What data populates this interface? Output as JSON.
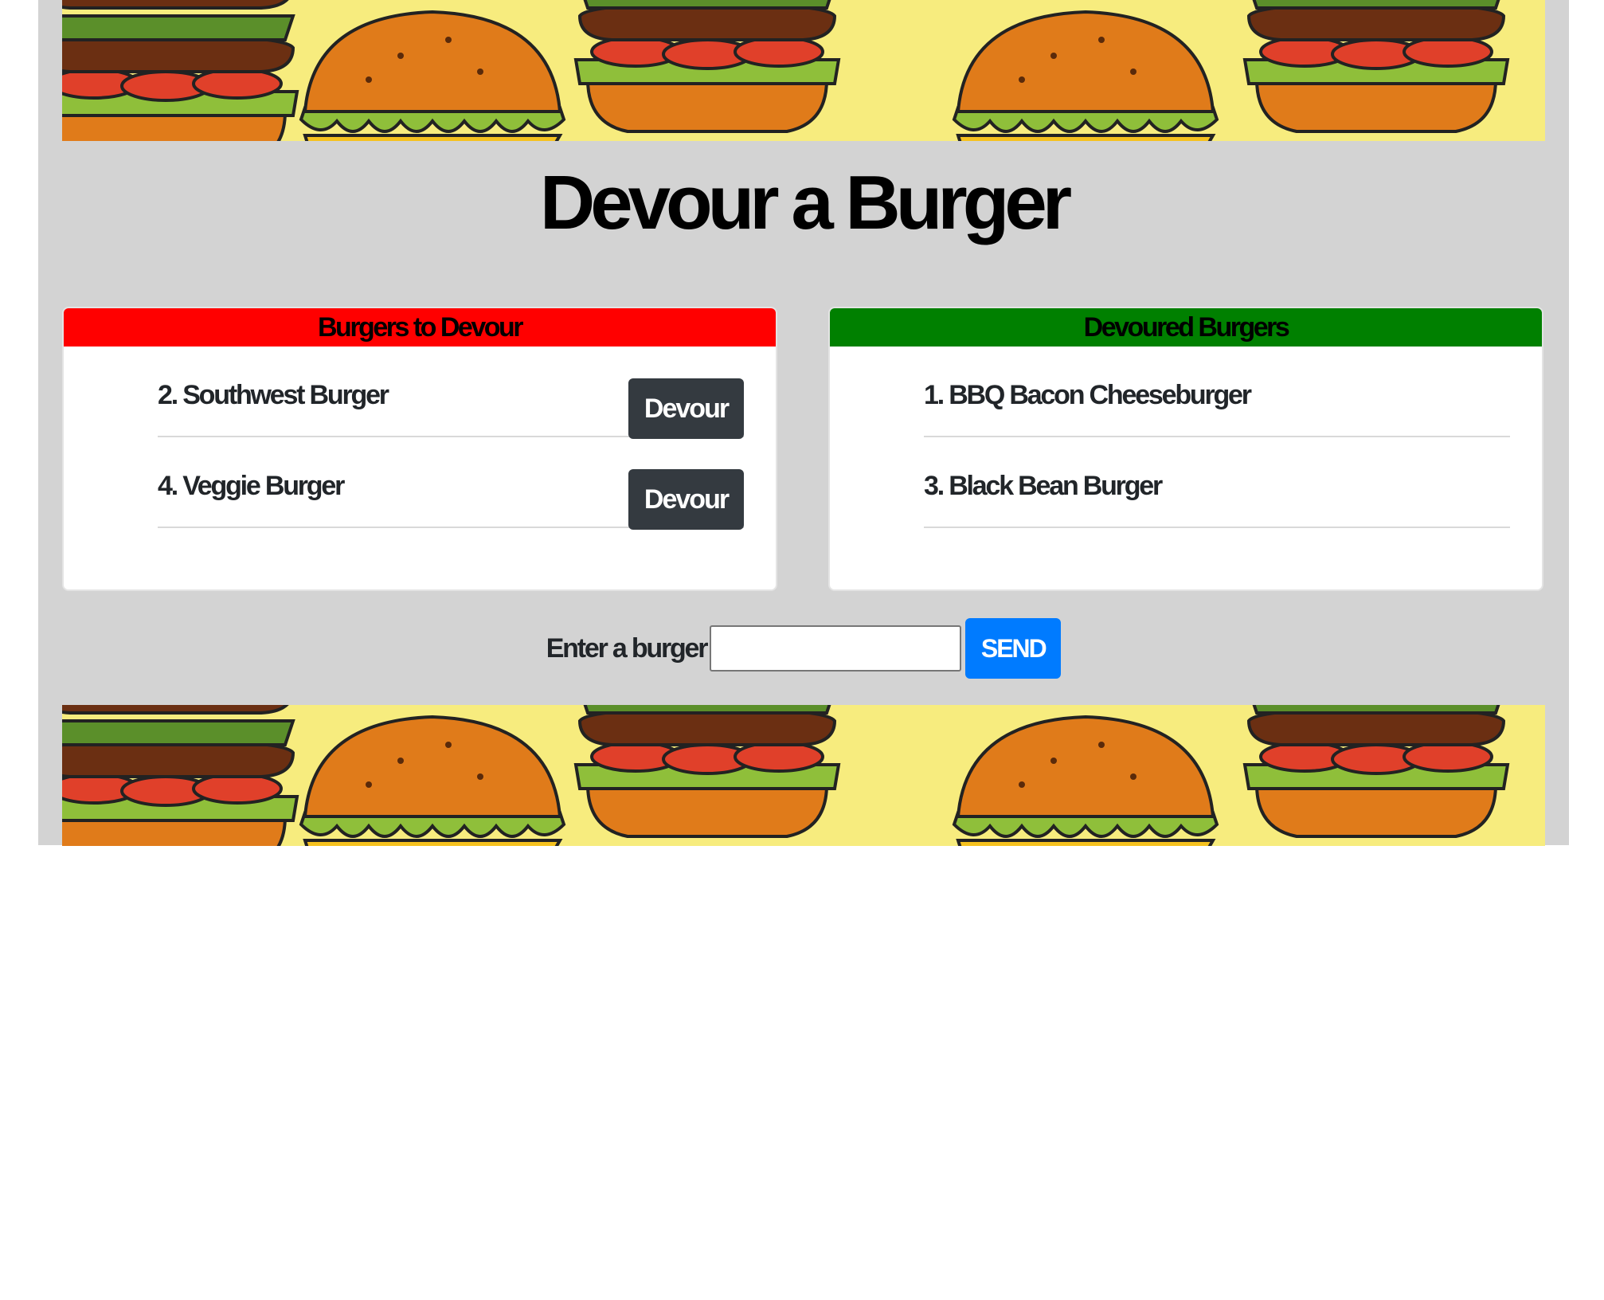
{
  "page": {
    "title": "Devour a Burger"
  },
  "to_devour": {
    "header": "Burgers to Devour",
    "items": [
      {
        "label": "2. Southwest Burger",
        "button": "Devour"
      },
      {
        "label": "4. Veggie Burger",
        "button": "Devour"
      }
    ]
  },
  "devoured": {
    "header": "Devoured Burgers",
    "items": [
      {
        "label": "1. BBQ Bacon Cheeseburger"
      },
      {
        "label": "3. Black Bean Burger"
      }
    ]
  },
  "form": {
    "label": "Enter a burger",
    "input_value": "",
    "submit_label": "SEND"
  },
  "colors": {
    "page_background": "#d3d3d3",
    "to_devour_header": "#ff0000",
    "devoured_header": "#008000",
    "devour_button": "#343a40",
    "send_button": "#007bff",
    "banner_background": "#f7ec7e"
  },
  "icons": {
    "banner": "burger-pattern-icon"
  }
}
